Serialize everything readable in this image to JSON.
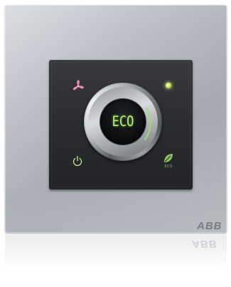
{
  "display": {
    "mode": "ECO",
    "mode_color": "#b6f07a"
  },
  "controls": {
    "fan_icon": "fan-icon",
    "fan_icon_color": "#e98aa6",
    "led_indicator_color": "#d7ef7a",
    "power_icon": "power-icon",
    "power_icon_color": "#b9d98e",
    "eco_button_icon": "leaf-icon",
    "eco_button_caption": "ECO",
    "eco_icon_color": "#8fbf5e"
  },
  "dial": {
    "type": "rotary-knob",
    "setpoint_color": "#9fdc6a"
  },
  "brand": {
    "logo_text": "ABB"
  }
}
